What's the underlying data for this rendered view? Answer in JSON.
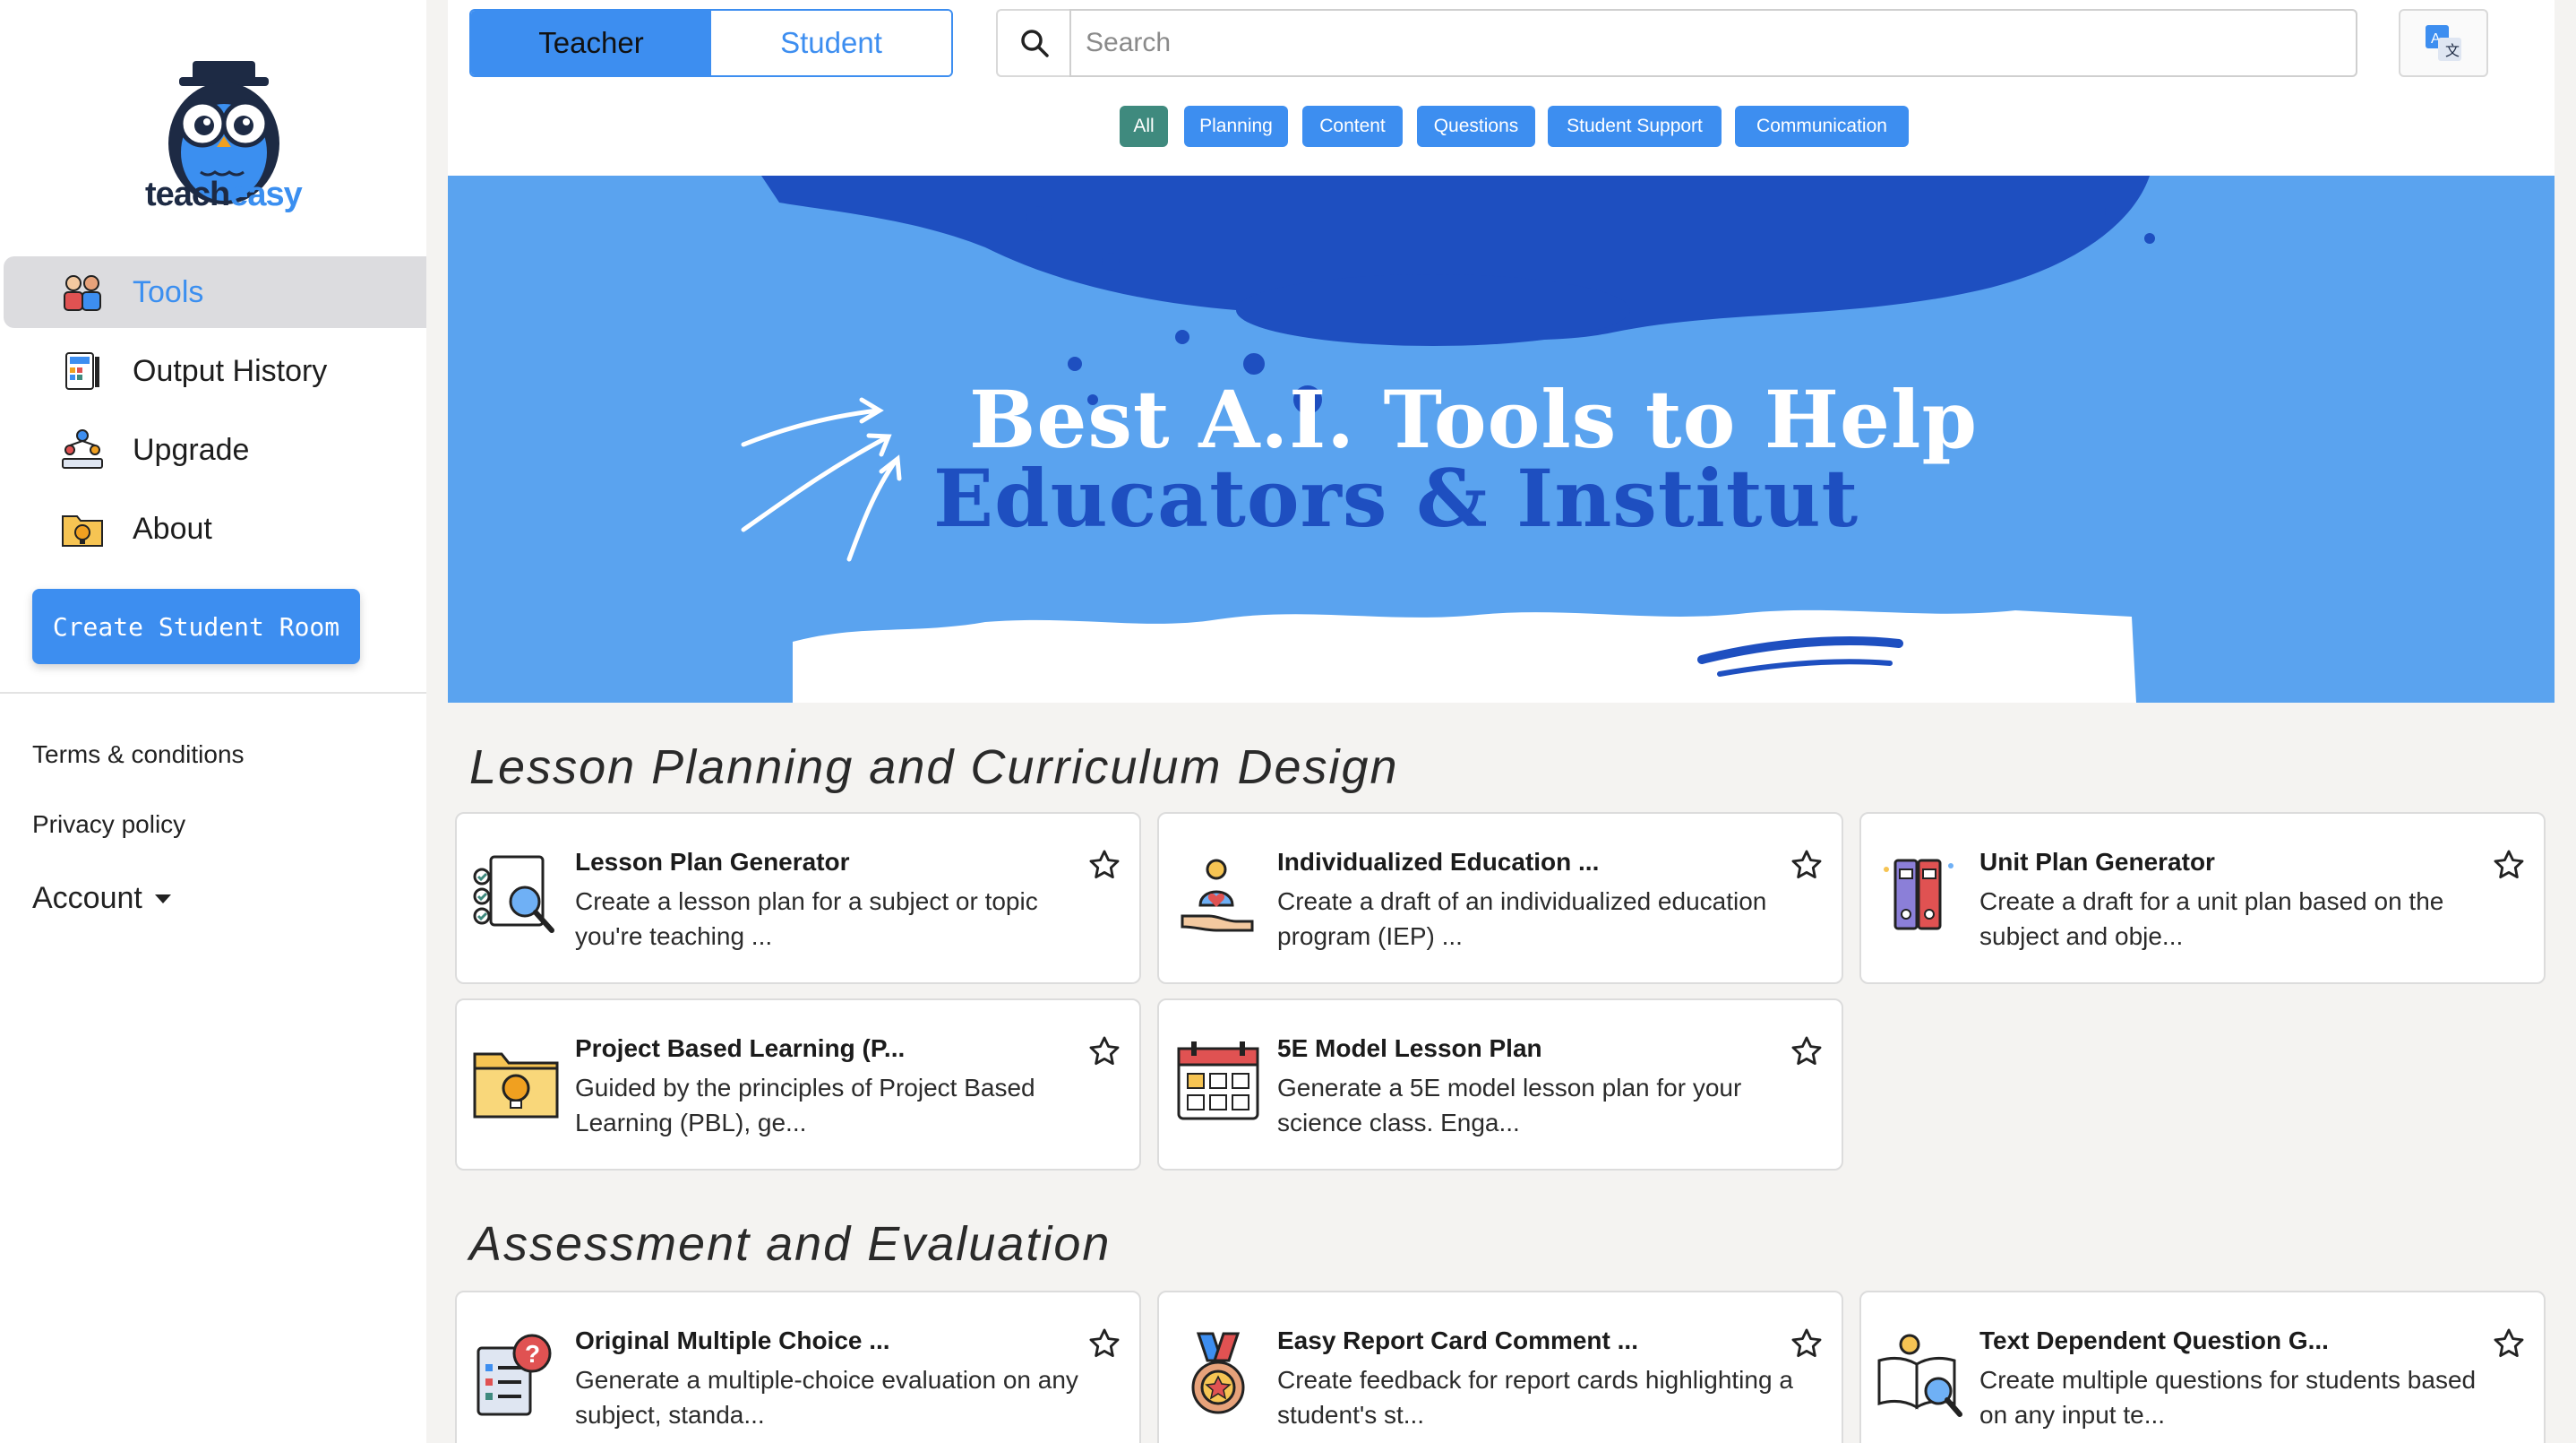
{
  "sidebar": {
    "logo": {
      "part1": "teach",
      "part2": "easy"
    },
    "items": [
      {
        "label": "Tools",
        "icon": "tools-icon",
        "active": true
      },
      {
        "label": "Output History",
        "icon": "output-history-icon"
      },
      {
        "label": "Upgrade",
        "icon": "upgrade-icon"
      },
      {
        "label": "About",
        "icon": "about-icon"
      }
    ],
    "create_room_label": "Create Student Room",
    "terms_label": "Terms & conditions",
    "privacy_label": "Privacy policy",
    "account_label": "Account"
  },
  "topbar": {
    "toggle": {
      "teacher": "Teacher",
      "student": "Student",
      "selected": "Teacher"
    },
    "search": {
      "placeholder": "Search"
    },
    "chips": [
      "All",
      "Planning",
      "Content",
      "Questions",
      "Student Support",
      "Communication"
    ],
    "selected_chip": "All"
  },
  "banner": {
    "line1": "Best A.I. Tools to Help",
    "line2": "Educators & Institut"
  },
  "sections": [
    {
      "title": "Lesson Planning and Curriculum Design",
      "cards": [
        {
          "title": "Lesson Plan Generator",
          "desc": "Create a lesson plan for a subject or topic you're teaching ...",
          "icon": "lesson-plan-icon"
        },
        {
          "title": "Individualized Education ...",
          "desc": "Create a draft of an individualized education program (IEP) ...",
          "icon": "individualized-education-icon"
        },
        {
          "title": "Unit Plan Generator",
          "desc": "Create a draft for a unit plan based on the subject and obje...",
          "icon": "unit-plan-icon"
        },
        {
          "title": "Project Based Learning (P...",
          "desc": "Guided by the principles of Project Based Learning (PBL), ge...",
          "icon": "project-folder-icon"
        },
        {
          "title": "5E Model Lesson Plan",
          "desc": "Generate a 5E model lesson plan for your science class. Enga...",
          "icon": "calendar-icon"
        }
      ]
    },
    {
      "title": "Assessment and Evaluation",
      "cards": [
        {
          "title": "Original Multiple Choice ...",
          "desc": "Generate a multiple-choice evaluation on any subject, standa...",
          "icon": "multiple-choice-icon"
        },
        {
          "title": "Easy Report Card Comment ...",
          "desc": "Create feedback for report cards highlighting a student's st...",
          "icon": "medal-icon"
        },
        {
          "title": "Text Dependent Question G...",
          "desc": "Create multiple questions for students based on any input te...",
          "icon": "text-question-icon"
        }
      ]
    }
  ],
  "colors": {
    "accent": "#3d8ef0",
    "active_chip": "#3f8a7e",
    "banner": "#5aa3ef",
    "banner_dark": "#1e4fc0"
  }
}
